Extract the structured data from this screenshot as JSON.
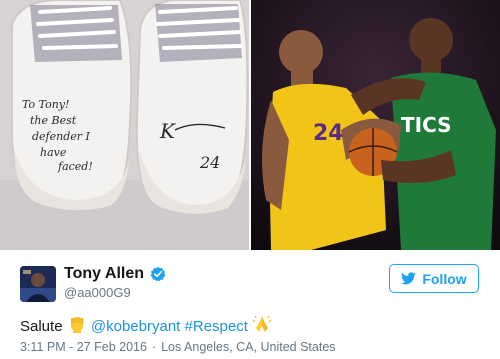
{
  "media": {
    "left_photo": {
      "icon": "shoes-photo",
      "signature": [
        "To Tony!",
        "the Best",
        "defender I",
        "have",
        "faced!"
      ],
      "autograph": [
        "K",
        "24"
      ]
    },
    "right_photo": {
      "icon": "basketball-photo",
      "jersey_left": "24",
      "jersey_right": "TICS"
    }
  },
  "tweet": {
    "author": {
      "name": "Tony Allen",
      "handle": "@aa000G9",
      "verified_icon": "verified-badge-icon"
    },
    "follow_button": {
      "label": "Follow",
      "icon": "twitter-bird-icon"
    },
    "text": {
      "word1": "Salute",
      "emoji1": "raised-fist-icon",
      "mention": "@kobebryant",
      "hashtag": "#Respect",
      "emoji2": "folded-hands-icon"
    },
    "meta": {
      "timestamp": "3:11 PM - 27 Feb 2016",
      "separator": "·",
      "location": "Los Angeles, CA, United States"
    }
  },
  "colors": {
    "accent": "#1da1f2",
    "link": "#1b95e0",
    "text": "#14171a",
    "muted": "#657786",
    "lakers_gold": "#f2c418",
    "celtics_green": "#1f7a3a"
  }
}
